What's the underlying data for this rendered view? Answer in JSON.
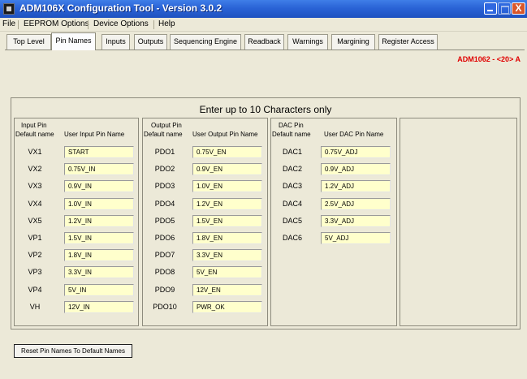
{
  "window": {
    "title": "ADM106X Configuration Tool -  Version 3.0.2",
    "close_glyph": "X"
  },
  "menu": {
    "items": [
      "File",
      "EEPROM Options",
      "Device Options",
      "Help"
    ]
  },
  "tabs": [
    {
      "label": "Top Level",
      "active": false
    },
    {
      "label": "Pin Names",
      "active": true
    },
    {
      "label": "Inputs",
      "active": false
    },
    {
      "label": "Outputs",
      "active": false
    },
    {
      "label": "Sequencing Engine",
      "active": false
    },
    {
      "label": "Readback",
      "active": false
    },
    {
      "label": "Warnings",
      "active": false
    },
    {
      "label": "Margining",
      "active": false
    },
    {
      "label": "Register Access",
      "active": false
    }
  ],
  "device_label": "ADM1062 - <20> A",
  "instruction": "Enter up to 10 Characters only",
  "input_pins": {
    "header_line1": "Input Pin",
    "header_default": "Default name",
    "header_user": "User Input Pin Name",
    "rows": [
      {
        "default": "VX1",
        "value": "START"
      },
      {
        "default": "VX2",
        "value": "0.75V_IN"
      },
      {
        "default": "VX3",
        "value": "0.9V_IN"
      },
      {
        "default": "VX4",
        "value": "1.0V_IN"
      },
      {
        "default": "VX5",
        "value": "1.2V_IN"
      },
      {
        "default": "VP1",
        "value": "1.5V_IN"
      },
      {
        "default": "VP2",
        "value": "1.8V_IN"
      },
      {
        "default": "VP3",
        "value": "3.3V_IN"
      },
      {
        "default": "VP4",
        "value": "5V_IN"
      },
      {
        "default": "VH",
        "value": "12V_IN"
      }
    ]
  },
  "output_pins": {
    "header_line1": "Output Pin",
    "header_default": "Default name",
    "header_user": "User Output Pin Name",
    "rows": [
      {
        "default": "PDO1",
        "value": "0.75V_EN"
      },
      {
        "default": "PDO2",
        "value": "0.9V_EN"
      },
      {
        "default": "PDO3",
        "value": "1.0V_EN"
      },
      {
        "default": "PDO4",
        "value": "1.2V_EN"
      },
      {
        "default": "PDO5",
        "value": "1.5V_EN"
      },
      {
        "default": "PDO6",
        "value": "1.8V_EN"
      },
      {
        "default": "PDO7",
        "value": "3.3V_EN"
      },
      {
        "default": "PDO8",
        "value": "5V_EN"
      },
      {
        "default": "PDO9",
        "value": "12V_EN"
      },
      {
        "default": "PDO10",
        "value": "PWR_OK"
      }
    ]
  },
  "dac_pins": {
    "header_line1": "DAC Pin",
    "header_default": "Default name",
    "header_user": "User DAC Pin Name",
    "rows": [
      {
        "default": "DAC1",
        "value": "0.75V_ADJ"
      },
      {
        "default": "DAC2",
        "value": "0.9V_ADJ"
      },
      {
        "default": "DAC3",
        "value": "1.2V_ADJ"
      },
      {
        "default": "DAC4",
        "value": "2.5V_ADJ"
      },
      {
        "default": "DAC5",
        "value": "3.3V_ADJ"
      },
      {
        "default": "DAC6",
        "value": "5V_ADJ"
      }
    ]
  },
  "reset_button": "Reset Pin Names To Default Names",
  "colors": {
    "title_bar": "#2a63d6",
    "window_bg": "#ece9d8",
    "field_bg": "#ffffcc",
    "device_label": "#e00000"
  }
}
